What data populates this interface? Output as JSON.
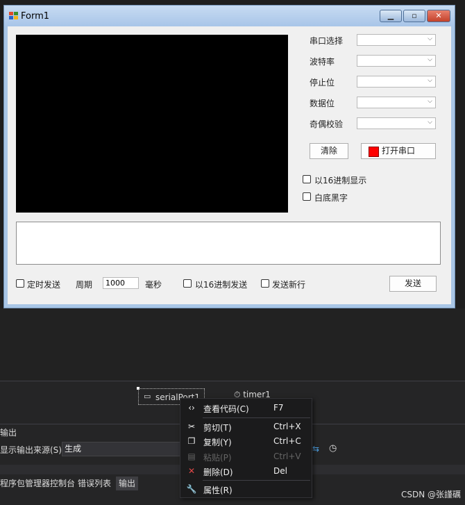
{
  "form": {
    "title": "Form1",
    "controls": {
      "labels": [
        "串口选择",
        "波特率",
        "停止位",
        "数据位",
        "奇偶校验"
      ],
      "clear_button": "清除",
      "open_port_button": "打开串口",
      "hex_display": "以16进制显示",
      "white_bg": "白底黑字",
      "timed_send": "定时发送",
      "period_label": "周期",
      "period_value": "1000",
      "ms_label": "毫秒",
      "hex_send": "以16进制发送",
      "send_newline": "发送新行",
      "send_button": "发送"
    },
    "status_color": "#ff0000"
  },
  "tray": {
    "serial_port": "serialPort1",
    "timer": "timer1"
  },
  "context_menu": [
    {
      "icon": "code-icon",
      "label": "查看代码(C)",
      "shortcut": "F7",
      "disabled": false
    },
    {
      "icon": "cut-icon",
      "label": "剪切(T)",
      "shortcut": "Ctrl+X",
      "disabled": false
    },
    {
      "icon": "copy-icon",
      "label": "复制(Y)",
      "shortcut": "Ctrl+C",
      "disabled": false
    },
    {
      "icon": "paste-icon",
      "label": "粘贴(P)",
      "shortcut": "Ctrl+V",
      "disabled": true
    },
    {
      "icon": "delete-icon",
      "label": "删除(D)",
      "shortcut": "Del",
      "disabled": false
    },
    {
      "icon": "wrench-icon",
      "label": "属性(R)",
      "shortcut": "",
      "disabled": false
    }
  ],
  "output": {
    "header": "输出",
    "source_label": "显示输出来源(S):",
    "source_value": "生成",
    "tabs": [
      "程序包管理器控制台",
      "错误列表",
      "输出"
    ]
  },
  "watermark": "CSDN @张謹礪"
}
